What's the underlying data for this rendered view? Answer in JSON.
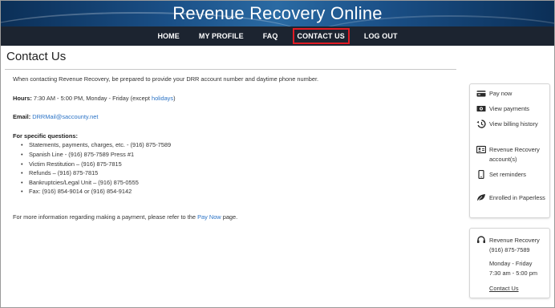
{
  "header": {
    "title": "Revenue Recovery Online"
  },
  "nav": {
    "items": [
      {
        "label": "HOME"
      },
      {
        "label": "MY PROFILE"
      },
      {
        "label": "FAQ"
      },
      {
        "label": "CONTACT US"
      },
      {
        "label": "LOG OUT"
      }
    ],
    "active_color": "#e01b24"
  },
  "page": {
    "title": "Contact Us"
  },
  "main": {
    "intro": "When contacting Revenue Recovery, be prepared to provide your DRR account number and daytime phone number.",
    "hours_label": "Hours:",
    "hours_text": "7:30 AM - 5:00 PM, Monday - Friday (except",
    "hours_link": "holidays",
    "hours_close": ")",
    "email_label": "Email:",
    "email_link": "DRRMail@saccounty.net",
    "questions_label": "For specific questions:",
    "questions": [
      "Statements, payments, charges, etc. - (916) 875-7589",
      "Spanish Line - (916) 875-7589 Press #1",
      "Victim Restitution – (916) 875-7815",
      "Refunds – (916) 875-7815",
      "Bankruptcies/Legal Unit – (916) 875-0555",
      "Fax: (916) 854-9014 or (916) 854-9142"
    ],
    "more_info_prefix": "For more information regarding making a payment, please refer to the",
    "more_info_link": "Pay Now",
    "more_info_suffix": "page."
  },
  "sidebar": {
    "items": [
      {
        "label": "Pay now",
        "icon": "credit-card-icon"
      },
      {
        "label": "View payments",
        "icon": "cash-icon"
      },
      {
        "label": "View billing history",
        "icon": "history-icon"
      },
      {
        "label": "Revenue Recovery account(s)",
        "icon": "id-card-icon"
      },
      {
        "label": "Set reminders",
        "icon": "phone-icon"
      },
      {
        "label": "Enrolled in Paperless",
        "icon": "leaf-icon"
      }
    ],
    "contact": {
      "icon": "headset-icon",
      "name": "Revenue Recovery",
      "phone": "(916) 875-7589",
      "days": "Monday - Friday",
      "hours": "7:30 am - 5:00 pm",
      "link": "Contact Us"
    }
  },
  "colors": {
    "link": "#2b73c6",
    "nav_bg": "#1c2430",
    "banner": "#1a4f86"
  }
}
